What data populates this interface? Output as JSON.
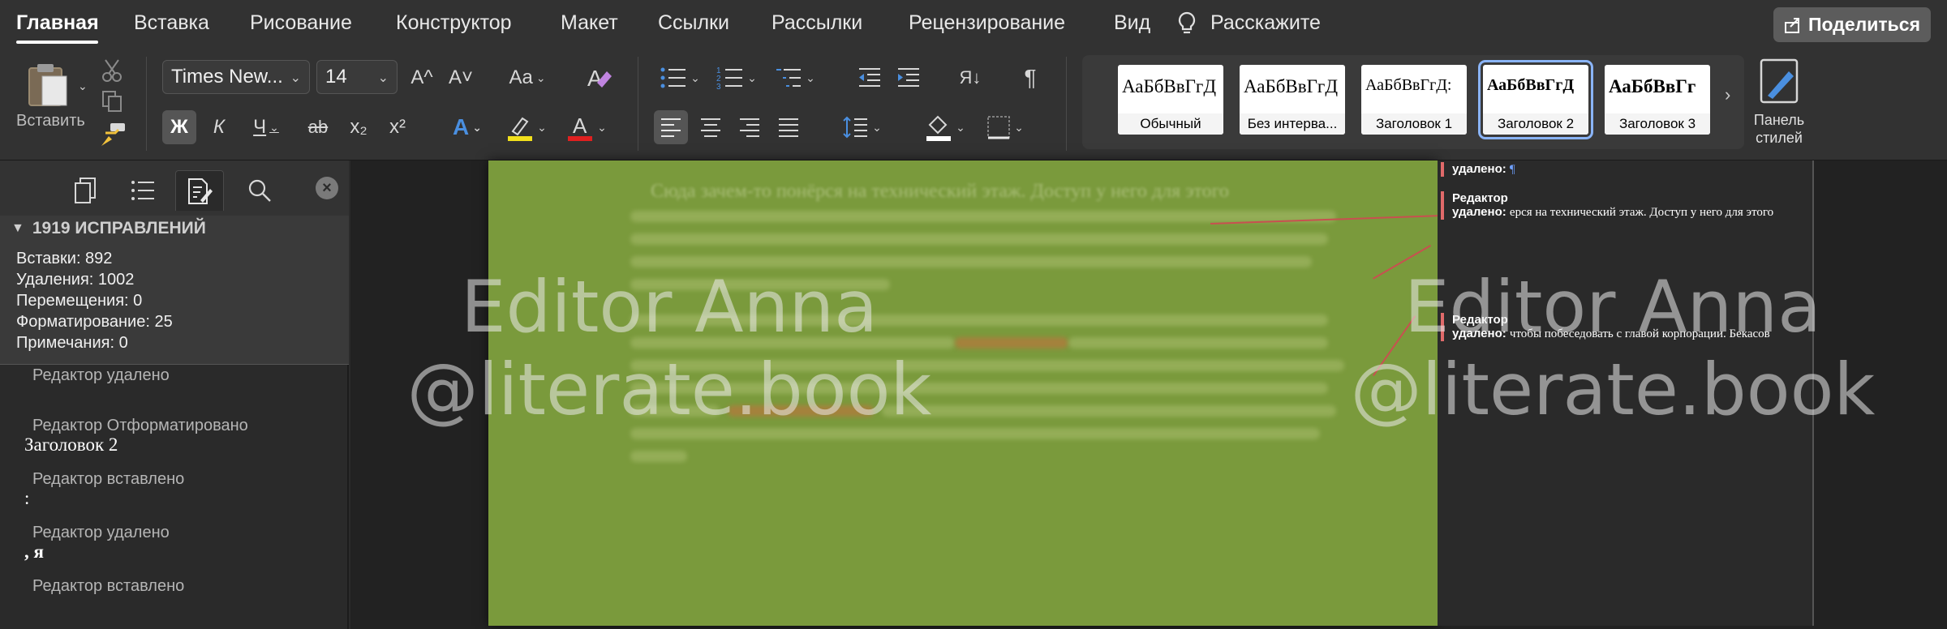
{
  "tabs": {
    "items": [
      {
        "label": "Главная",
        "active": true
      },
      {
        "label": "Вставка"
      },
      {
        "label": "Рисование"
      },
      {
        "label": "Конструктор"
      },
      {
        "label": "Макет"
      },
      {
        "label": "Ссылки"
      },
      {
        "label": "Рассылки"
      },
      {
        "label": "Рецензирование"
      },
      {
        "label": "Вид"
      }
    ],
    "tell_me": "Расскажите",
    "share": "Поделиться"
  },
  "ribbon": {
    "paste_label": "Вставить",
    "font_name": "Times New...",
    "font_size": "14",
    "bold_glyph": "Ж",
    "italic_glyph": "К",
    "underline_glyph": "Ч",
    "strike_glyph": "ab",
    "subscript_glyph": "x₂",
    "superscript_glyph": "x²",
    "grow_glyph": "A^",
    "shrink_glyph": "A˅",
    "case_glyph": "Aa",
    "pilcrow_glyph": "¶",
    "sort_glyph": "Я↓",
    "styles": [
      {
        "preview": "АаБбВвГгД",
        "name": "Обычный",
        "bold": false
      },
      {
        "preview": "АаБбВвГгД",
        "name": "Без интерва...",
        "bold": false
      },
      {
        "preview": "АаБбВвГгД:",
        "name": "Заголовок 1",
        "bold": false
      },
      {
        "preview": "АаБбВвГгД",
        "name": "Заголовок 2",
        "bold": true,
        "selected": true
      },
      {
        "preview": "АаБбВвГг",
        "name": "Заголовок 3",
        "bold": true
      }
    ],
    "styles_pane_label_1": "Панель",
    "styles_pane_label_2": "стилей",
    "accent_highlight": "#f2e01c",
    "accent_font_color": "#e02020"
  },
  "revisions": {
    "header": "1919 ИСПРАВЛЕНИЙ",
    "stats": [
      "Вставки: 892",
      "Удаления: 1002",
      "Перемещения: 0",
      "Форматирование: 25",
      "Примечания: 0"
    ],
    "items": [
      {
        "meta": "Редактор удалено",
        "text": ""
      },
      {
        "meta": "Редактор Отформатировано",
        "text": "Заголовок 2"
      },
      {
        "meta": "Редактор вставлено",
        "text": ":"
      },
      {
        "meta": "Редактор удалено",
        "text": ", я"
      },
      {
        "meta": "Редактор вставлено",
        "text": ""
      }
    ]
  },
  "document": {
    "para_line": "Сюда зачем-то понёрся на технический этаж. Доступ у него для этого",
    "balloons": [
      {
        "who": "",
        "label": "удалено:",
        "text": "¶"
      },
      {
        "who": "Редактор",
        "label": "удалено:",
        "text": "ерся на технический этаж. Доступ у него для этого"
      },
      {
        "who": "Редактор",
        "label": "удалено:",
        "text": "чтобы побеседовать с главой корпорации. Бекасов"
      }
    ],
    "page_color": "#7a9a3c"
  },
  "watermark": {
    "line1": "Editor Anna",
    "line2": "@literate.book"
  }
}
